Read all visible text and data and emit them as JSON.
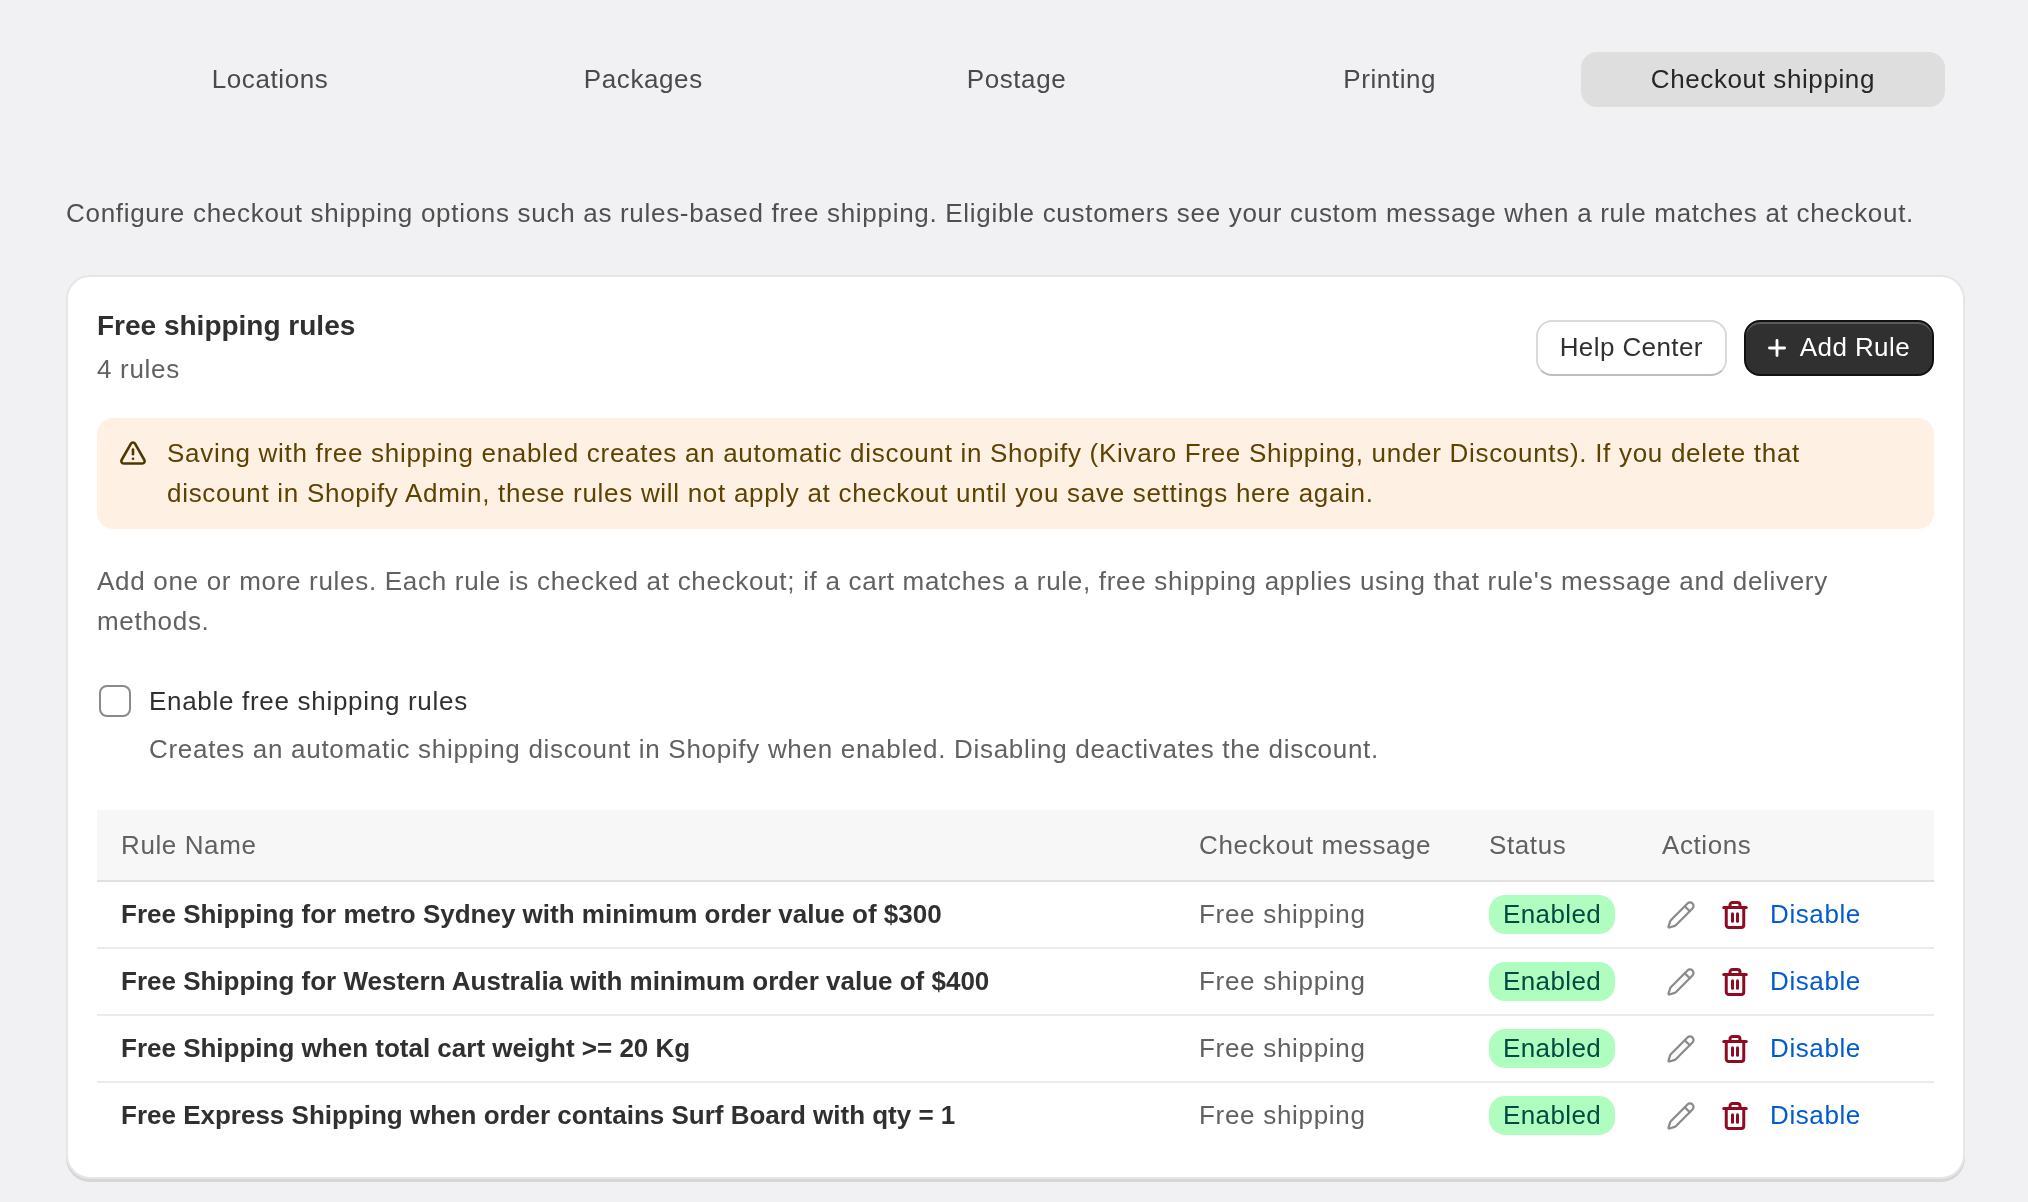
{
  "tabs": [
    {
      "label": "Locations",
      "selected": false
    },
    {
      "label": "Packages",
      "selected": false
    },
    {
      "label": "Postage",
      "selected": false
    },
    {
      "label": "Printing",
      "selected": false
    },
    {
      "label": "Checkout shipping",
      "selected": true
    }
  ],
  "description": "Configure checkout shipping options such as rules-based free shipping. Eligible customers see your custom message when a rule matches at checkout.",
  "rules_card": {
    "title": "Free shipping rules",
    "subtitle": "4 rules",
    "buttons": [
      {
        "kind": "secondary",
        "label": "Help Center"
      },
      {
        "kind": "primary",
        "label": "Add Rule"
      }
    ],
    "warning": "Saving with free shipping enabled creates an automatic discount in Shopify (Kivaro Free Shipping, under Discounts). If you delete that discount in Shopify Admin, these rules will not apply at checkout until you save settings here again.",
    "intro": "Add one or more rules. Each rule is checked at checkout; if a cart matches a rule, free shipping applies using that rule's message and delivery methods.",
    "enable_option": {
      "label": "Enable free shipping rules",
      "checked": false,
      "help": "Creates an automatic shipping discount in Shopify when enabled. Disabling deactivates the discount."
    },
    "table": {
      "columns": [
        "Rule Name",
        "Checkout message",
        "Status",
        "Actions"
      ],
      "rows": [
        {
          "rule_name": "Free Shipping for metro Sydney with minimum order value of $300",
          "checkout_message": "Free shipping",
          "status": "Enabled",
          "action": "Disable"
        },
        {
          "rule_name": "Free Shipping for Western Australia with minimum order value of $400",
          "checkout_message": "Free shipping",
          "status": "Enabled",
          "action": "Disable"
        },
        {
          "rule_name": "Free Shipping when total cart weight >= 20 Kg",
          "checkout_message": "Free shipping",
          "status": "Enabled",
          "action": "Disable"
        },
        {
          "rule_name": "Free Express Shipping when order contains Surf Board with qty = 1",
          "checkout_message": "Free shipping",
          "status": "Enabled",
          "action": "Disable"
        }
      ]
    }
  }
}
